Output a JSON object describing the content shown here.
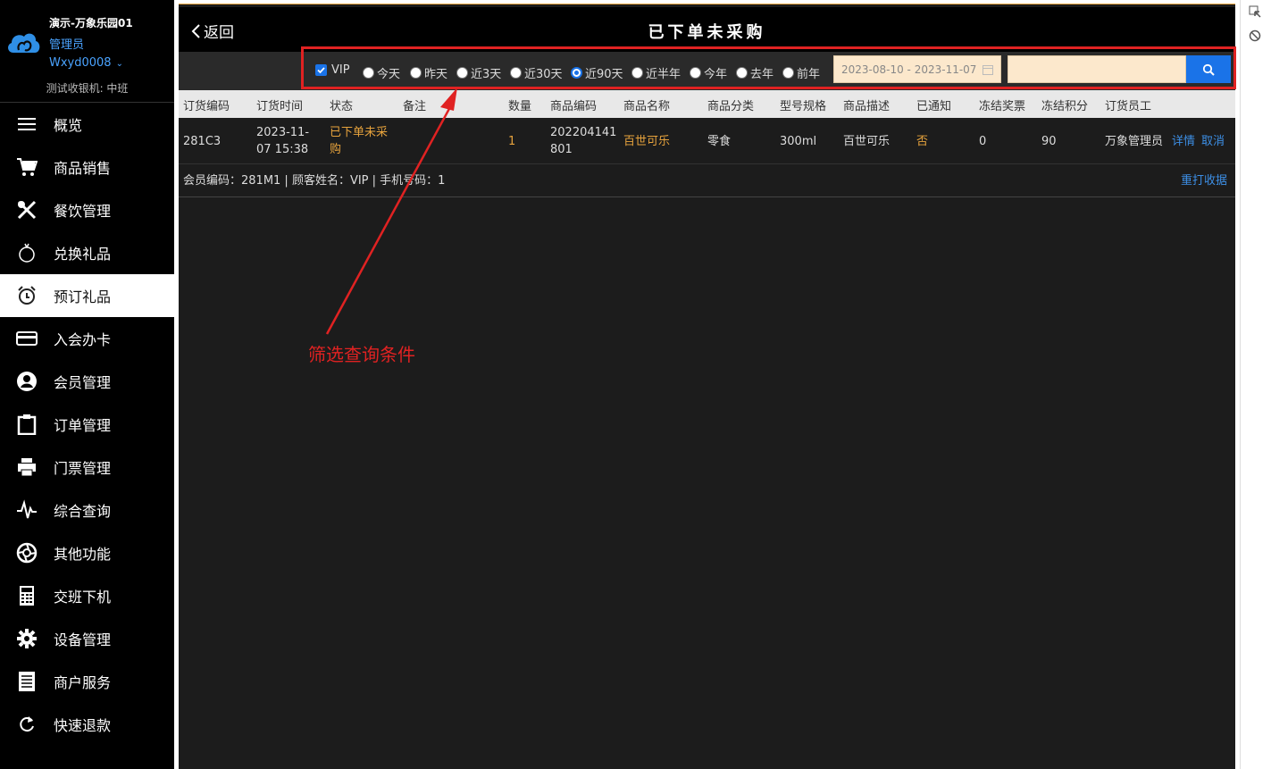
{
  "sidebar": {
    "store_name": "演示-万象乐园01",
    "role": "管理员",
    "user": "Wxyd0008",
    "cashier": "测试收银机: 中班",
    "items": [
      {
        "label": "概览",
        "icon": "menu-icon"
      },
      {
        "label": "商品销售",
        "icon": "cart-icon"
      },
      {
        "label": "餐饮管理",
        "icon": "utensils-icon"
      },
      {
        "label": "兑换礼品",
        "icon": "gift-icon"
      },
      {
        "label": "预订礼品",
        "icon": "alarm-clock-icon"
      },
      {
        "label": "入会办卡",
        "icon": "credit-card-icon"
      },
      {
        "label": "会员管理",
        "icon": "user-icon"
      },
      {
        "label": "订单管理",
        "icon": "clipboard-icon"
      },
      {
        "label": "门票管理",
        "icon": "printer-icon"
      },
      {
        "label": "综合查询",
        "icon": "pulse-icon"
      },
      {
        "label": "其他功能",
        "icon": "aperture-icon"
      },
      {
        "label": "交班下机",
        "icon": "calculator-icon"
      },
      {
        "label": "设备管理",
        "icon": "gear-icon"
      },
      {
        "label": "商户服务",
        "icon": "document-icon"
      },
      {
        "label": "快速退款",
        "icon": "refresh-icon"
      }
    ],
    "active_index": 4
  },
  "header": {
    "back_label": "返回",
    "title": "已下单未采购"
  },
  "filters": {
    "vip_label": "VIP",
    "vip_checked": true,
    "ranges": [
      "今天",
      "昨天",
      "近3天",
      "近30天",
      "近90天",
      "近半年",
      "今年",
      "去年",
      "前年"
    ],
    "selected_range": "近90天",
    "date_range": "2023-08-10 - 2023-11-07",
    "search_placeholder": ""
  },
  "table": {
    "columns": [
      "订货编码",
      "订货时间",
      "状态",
      "备注",
      "数量",
      "商品编码",
      "商品名称",
      "商品分类",
      "型号规格",
      "商品描述",
      "已通知",
      "冻结奖票",
      "冻结积分",
      "订货员工"
    ],
    "rows": [
      {
        "code": "281C3",
        "time_line1": "2023-11-",
        "time_line2": "07 15:38",
        "status_line1": "已下单未采",
        "status_line2": "购",
        "note": "",
        "qty": "1",
        "item_code_line1": "202204141",
        "item_code_line2": "801",
        "item_name": "百世可乐",
        "category": "零食",
        "spec": "300ml",
        "desc": "百世可乐",
        "notified": "否",
        "frozen_tickets": "0",
        "frozen_points": "90",
        "staff": "万象管理员",
        "detail_link": "详情",
        "cancel_link": "取消"
      }
    ],
    "member_info": "会员编码：281M1 | 顾客姓名：VIP | 手机号码：1",
    "reprint_link": "重打收据"
  },
  "annotation": {
    "label": "筛选查询条件",
    "color": "#e02222"
  },
  "colors": {
    "accent": "#1a73e8",
    "orange": "#e7a33d",
    "highlight": "#e02222"
  }
}
